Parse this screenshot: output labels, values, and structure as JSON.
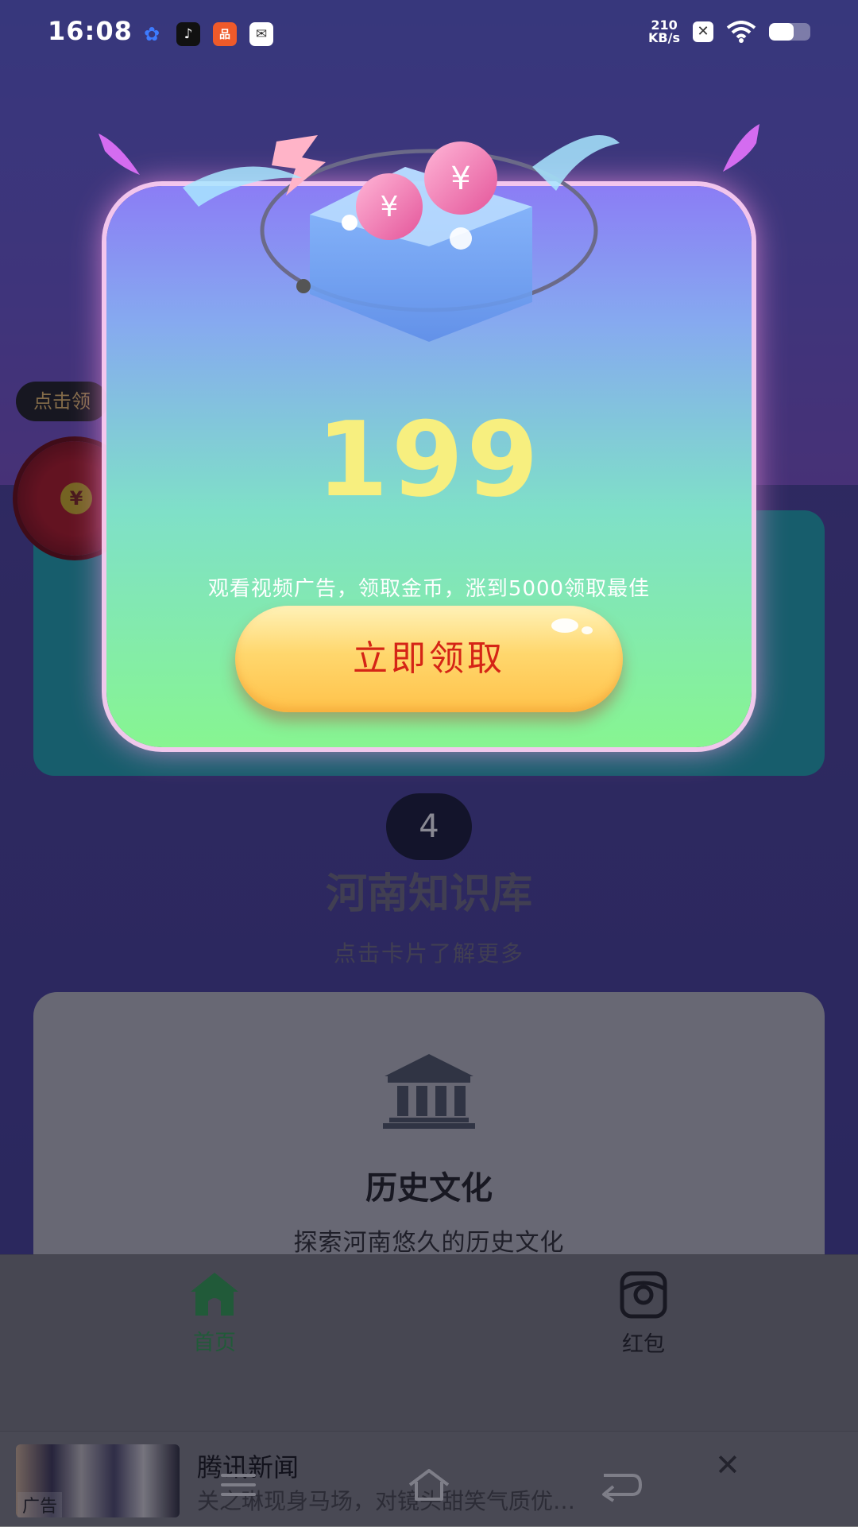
{
  "status_bar": {
    "time": "16:08",
    "net_speed_value": "210",
    "net_speed_unit": "KB/s",
    "battery_level": 0.6,
    "app_icons": [
      "baidu-icon",
      "tiktok-icon",
      "shopping-app-icon",
      "mail-icon"
    ]
  },
  "background": {
    "floating_tip": "点击领",
    "step_number": "4",
    "section_title": "河南知识库",
    "section_subtitle": "点击卡片了解更多",
    "card": {
      "icon": "museum-icon",
      "title": "历史文化",
      "description": "探索河南悠久的历史文化"
    }
  },
  "dialog": {
    "coin_value": "199",
    "description": "观看视频广告，领取金币，涨到5000领取最佳",
    "claim_button": "立即领取"
  },
  "tab_bar": {
    "items": [
      {
        "label": "首页",
        "icon": "home-icon",
        "active": true,
        "color": "#2ea04a"
      },
      {
        "label": "红包",
        "icon": "red-envelope-icon",
        "active": false,
        "color": "#1c1c1c"
      }
    ]
  },
  "ad_banner": {
    "badge": "广告",
    "title": "腾讯新闻",
    "description": "关之琳现身马场，对镜头甜笑气质优…"
  },
  "colors": {
    "accent_gold": "#f7ef7f",
    "button_text": "#d52516",
    "active_tab": "#2ea04a"
  }
}
